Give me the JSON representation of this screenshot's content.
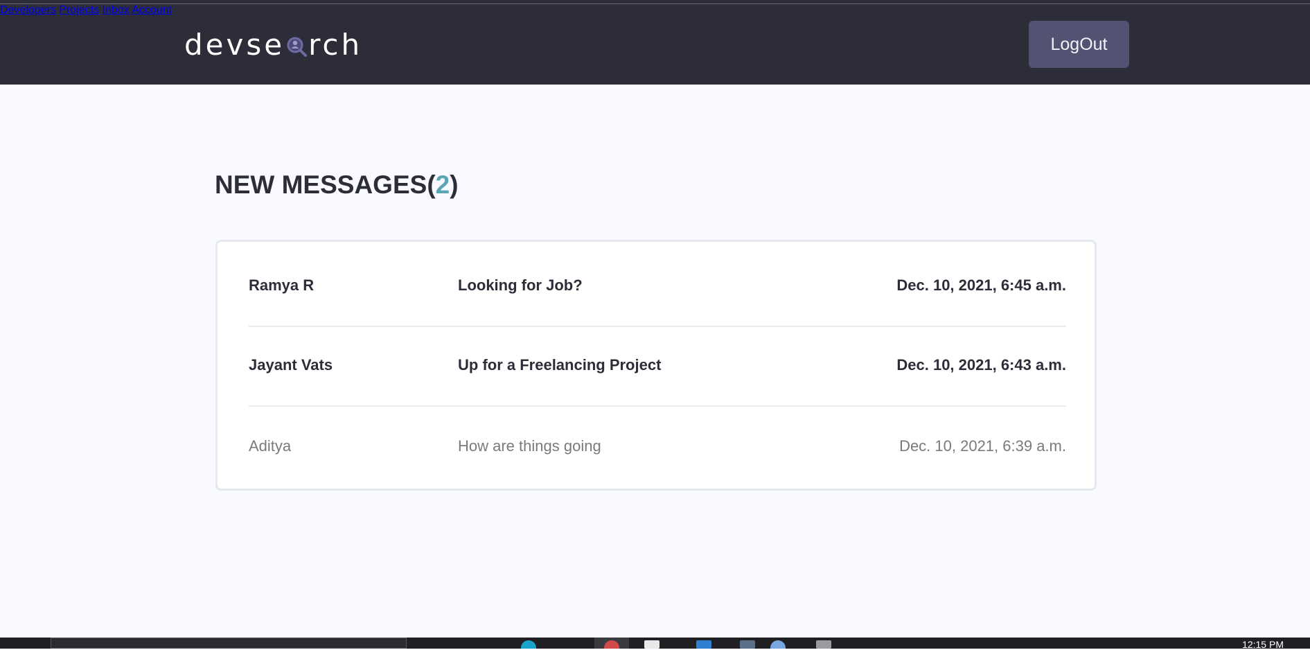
{
  "brand": {
    "logo_text_before": "devse",
    "logo_text_after": "rch"
  },
  "nav": {
    "developers": "Developers",
    "projects": "Projects",
    "inbox": "Inbox",
    "account": "Account",
    "logout": "LogOut"
  },
  "page": {
    "heading_prefix": "NEW MESSAGES",
    "open_paren": "(",
    "new_count": "2",
    "close_paren": ")"
  },
  "messages": [
    {
      "sender": "Ramya R",
      "subject": "Looking for Job?",
      "date": "Dec. 10, 2021, 6:45 a.m.",
      "unread": true
    },
    {
      "sender": "Jayant Vats",
      "subject": "Up for a Freelancing Project",
      "date": "Dec. 10, 2021, 6:43 a.m.",
      "unread": true
    },
    {
      "sender": "Aditya",
      "subject": "How are things going",
      "date": "Dec. 10, 2021, 6:39 a.m.",
      "unread": false
    }
  ],
  "taskbar": {
    "clock": "12:15 PM"
  },
  "colors": {
    "header_bg": "#2d2d39",
    "page_bg": "#f8faff",
    "accent": "#5aa6b3",
    "logout_bg": "#525373",
    "logo_icon": "#6e6aa3"
  },
  "icons": {
    "logo_search": "magnifier-with-person-icon"
  }
}
